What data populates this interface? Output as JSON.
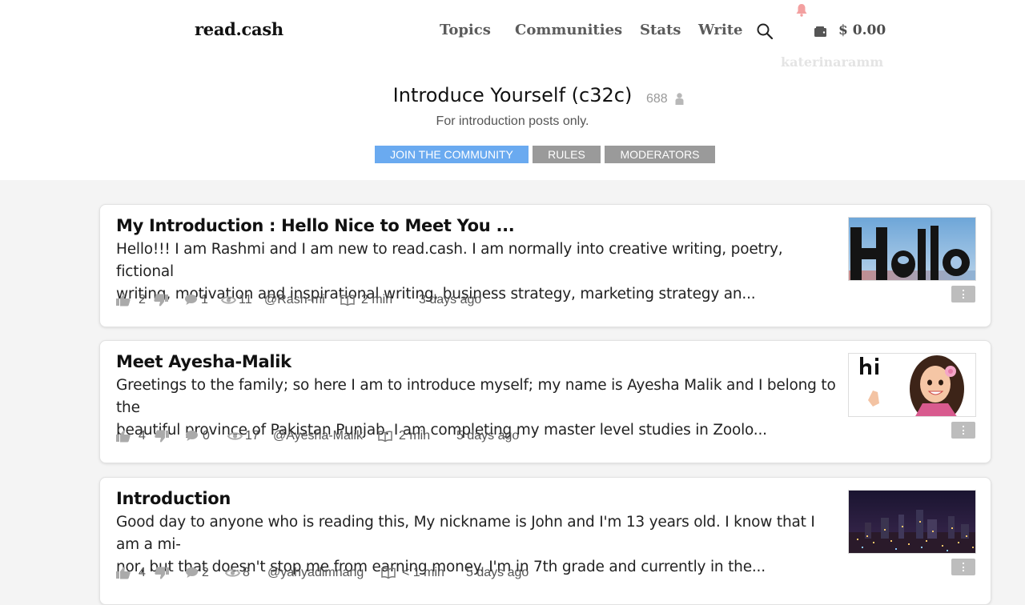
{
  "header": {
    "logo": "read.cash",
    "nav": [
      "Topics",
      "Communities",
      "Stats",
      "Write"
    ],
    "balance": "$ 0.00",
    "username": "katerinaramm"
  },
  "community": {
    "title": "Introduce Yourself (c32c)",
    "member_count": "688",
    "description": "For introduction posts only.",
    "buttons": {
      "join": "JOIN THE COMMUNITY",
      "rules": "RULES",
      "moderators": "MODERATORS"
    }
  },
  "colors": {
    "join_button": "#6aaaf0",
    "secondary_button": "#9a9a9a",
    "notification_bell": "#f3a0a0"
  },
  "posts": [
    {
      "title": "My Introduction : Hello Nice to Meet You ...",
      "excerpt_line1": "Hello!!! I am Rashmi and I am new to read.cash. I am normally into creative writing, poetry, fictional",
      "excerpt_line2": "writing, motivation and inspirational writing, business strategy, marketing strategy an...",
      "likes": "2",
      "comments": "1",
      "views": "11",
      "author": "@Rash-mi",
      "read_time": "2 min",
      "age": "3 days ago",
      "thumbnail": "hello-image"
    },
    {
      "title": "Meet Ayesha-Malik",
      "excerpt_line1": "Greetings to the family; so here I am to introduce myself; my name is Ayesha Malik and I belong to the",
      "excerpt_line2": "beautiful province of Pakistan Punjab. I am completing my master level studies in Zoolo...",
      "likes": "4",
      "comments": "0",
      "views": "17",
      "author": "@Ayesha-Malik",
      "read_time": "2 min",
      "age": "5 days ago",
      "thumbnail": "hi-cartoon-image"
    },
    {
      "title": "Introduction",
      "excerpt_line1": "Good day to anyone who is reading this, My nickname is John and I'm 13 years old. I know that I am a mi-",
      "excerpt_line2": "nor, but that doesn't stop me from earning money. I'm in 7th grade and currently in the...",
      "likes": "4",
      "comments": "2",
      "views": "8",
      "author": "@yahyadimnang",
      "read_time": "< 1 min",
      "age": "5 days ago",
      "thumbnail": "city-night-image"
    }
  ]
}
